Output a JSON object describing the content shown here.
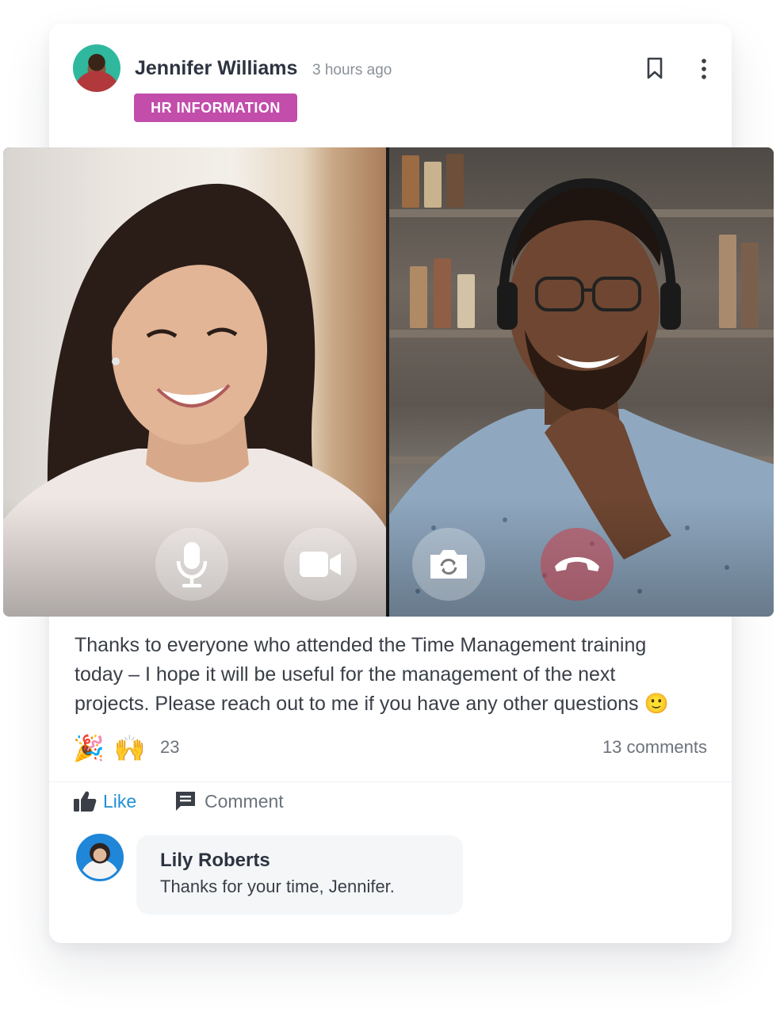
{
  "post": {
    "author": "Jennifer Williams",
    "time": "3 hours ago",
    "tag": "HR INFORMATION",
    "body": "Thanks to everyone who attended the Time Management training today – I hope it will be useful for the management of the next projects. Please reach out to me if you have any other questions 🙂",
    "reactions": {
      "emojis": [
        "🎉",
        "🙌"
      ],
      "count": "23"
    },
    "comments_count": "13 comments",
    "actions": {
      "like": "Like",
      "comment": "Comment"
    }
  },
  "call_controls": {
    "icons": [
      "microphone-icon",
      "video-camera-icon",
      "switch-camera-icon",
      "end-call-icon"
    ]
  },
  "comment": {
    "author": "Lily Roberts",
    "text": "Thanks for your time, Jennifer."
  },
  "colors": {
    "tag": "#c24dab",
    "like": "#1f8fd6",
    "author_avatar_bg": "#2fb89d",
    "commenter_avatar_bg": "#1f86d8"
  }
}
